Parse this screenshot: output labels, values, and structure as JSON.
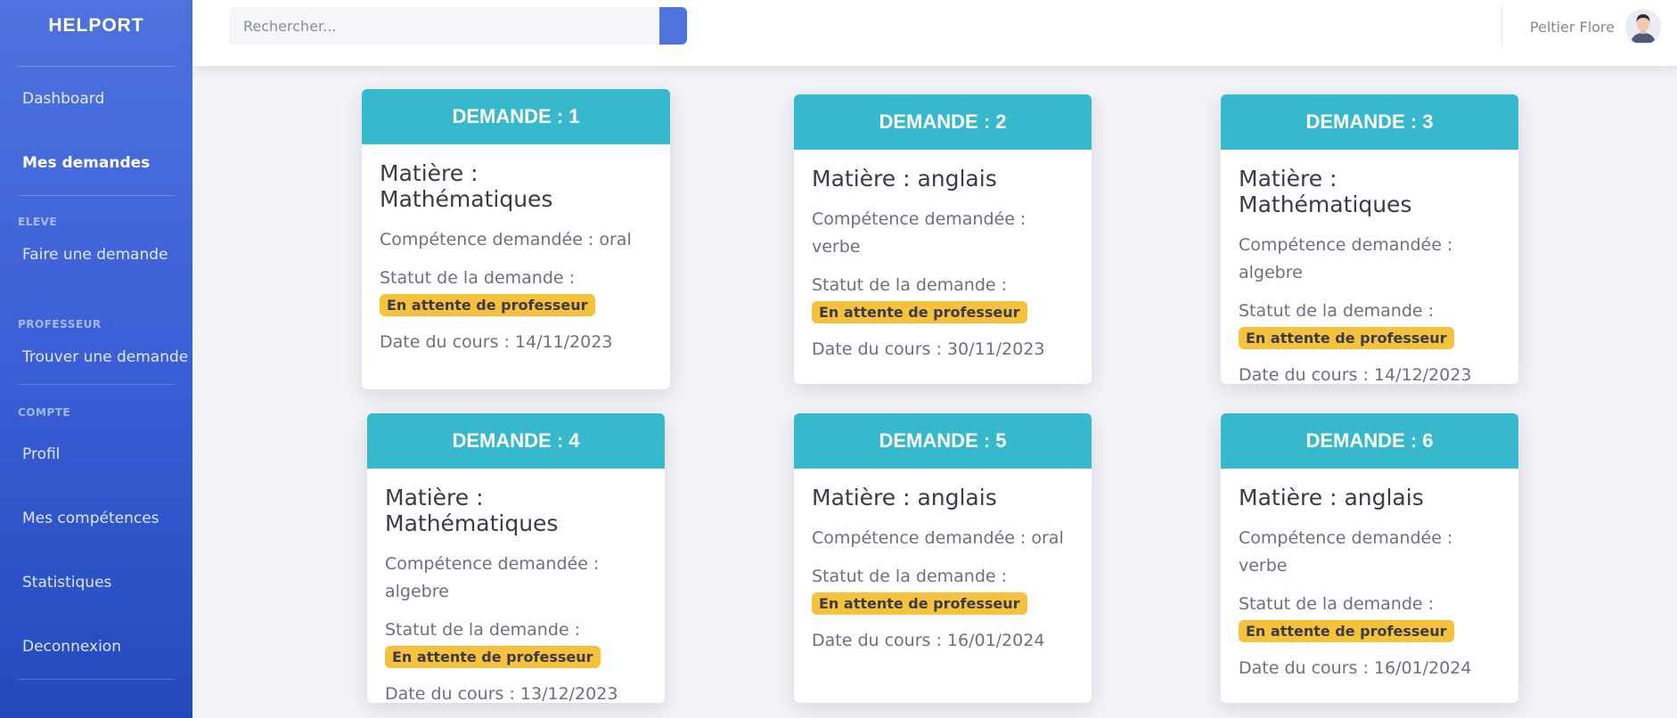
{
  "brand": "HELPORT",
  "nav": {
    "dashboard": "Dashboard",
    "mes_demandes": "Mes demandes",
    "heading_eleve": "ELEVE",
    "faire_demande": "Faire une demande",
    "heading_professeur": "PROFESSEUR",
    "trouver_demande": "Trouver une demande",
    "heading_compte": "COMPTE",
    "profil": "Profil",
    "mes_competences": "Mes compétences",
    "statistiques": "Statistiques",
    "deconnexion": "Deconnexion"
  },
  "search": {
    "placeholder": "Rechercher..."
  },
  "user": {
    "name": "Peltier Flore"
  },
  "cards": [
    {
      "header": "DEMANDE : 1",
      "subject": "Matière : Mathématiques",
      "competence": "Compétence demandée : oral",
      "status_label": "Statut de la demande :",
      "status": "En attente de professeur",
      "date": "Date du cours : 14/11/2023"
    },
    {
      "header": "DEMANDE : 2",
      "subject": "Matière : anglais",
      "competence": "Compétence demandée : verbe",
      "status_label": "Statut de la demande :",
      "status": "En attente de professeur",
      "date": "Date du cours : 30/11/2023"
    },
    {
      "header": "DEMANDE : 3",
      "subject": "Matière : Mathématiques",
      "competence": "Compétence demandée : algebre",
      "status_label": "Statut de la demande :",
      "status": "En attente de professeur",
      "date": "Date du cours : 14/12/2023"
    },
    {
      "header": "DEMANDE : 4",
      "subject": "Matière : Mathématiques",
      "competence": "Compétence demandée : algebre",
      "status_label": "Statut de la demande :",
      "status": "En attente de professeur",
      "date": "Date du cours : 13/12/2023"
    },
    {
      "header": "DEMANDE : 5",
      "subject": "Matière : anglais",
      "competence": "Compétence demandée : oral",
      "status_label": "Statut de la demande :",
      "status": "En attente de professeur",
      "date": "Date du cours : 16/01/2024"
    },
    {
      "header": "DEMANDE : 6",
      "subject": "Matière : anglais",
      "competence": "Compétence demandée : verbe",
      "status_label": "Statut de la demande :",
      "status": "En attente de professeur",
      "date": "Date du cours : 16/01/2024"
    }
  ],
  "colors": {
    "sidebar": "#4e73df",
    "card_header": "#36b9cc",
    "badge": "#f6c23e"
  }
}
